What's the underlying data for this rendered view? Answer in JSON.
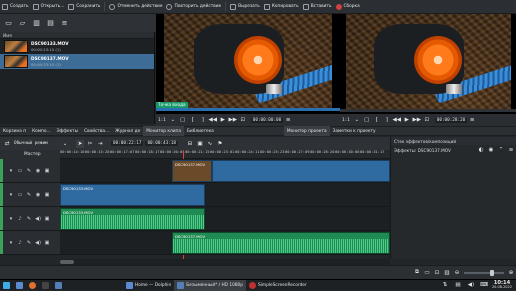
{
  "menu": {
    "items": [
      {
        "label": "Создать",
        "icon": "new-file-icon"
      },
      {
        "label": "Открыть...",
        "icon": "open-folder-icon"
      },
      {
        "label": "Сохранить",
        "icon": "save-icon"
      },
      {
        "label": "Отменить действие",
        "icon": "undo-icon"
      },
      {
        "label": "Повторить действие",
        "icon": "redo-icon"
      },
      {
        "label": "Вырезать",
        "icon": "cut-icon"
      },
      {
        "label": "Копировать",
        "icon": "copy-icon"
      },
      {
        "label": "Вставить",
        "icon": "paste-icon"
      },
      {
        "label": "Сборка",
        "icon": "render-icon"
      }
    ]
  },
  "bin": {
    "header": "Имя",
    "clips": [
      {
        "name": "DSC90133.MOV",
        "duration": "00:00:23:10 (1)"
      },
      {
        "name": "DSC90137.MOV",
        "duration": "00:00:23:10 (1)"
      }
    ]
  },
  "clip_monitor": {
    "zone_label": "Точка входа",
    "zoom": "1:1",
    "timecode": "00:00:00:00"
  },
  "project_monitor": {
    "zoom": "1:1",
    "timecode": "00:00:28:20"
  },
  "tabs": {
    "left": [
      "Корзина п",
      "Компо...",
      "Эффекты",
      "Свойства...",
      "Журнал де",
      "Монитор клипа",
      "Библиотека"
    ],
    "right": [
      "Монитор проекта",
      "Заметки к проекту"
    ]
  },
  "timeline": {
    "mode": "Обычный режим",
    "position": "00:00:22:17",
    "duration": "00:00:43:18",
    "master_label": "Мастер",
    "ruler_ticks": [
      "00:00:14:10",
      "00:00:15:20",
      "00:00:17:07",
      "00:00:18:17",
      "00:00:20:04",
      "00:00:21:15",
      "00:00:23:01",
      "00:00:24:11",
      "00:00:25:23",
      "00:00:27:09",
      "00:00:28:20",
      "00:00:30:06",
      "00:00:31:17"
    ],
    "clips": {
      "v2": "DSC90137.MOV",
      "v1": "DSC90133.MOV",
      "a1": "DSC90133.MOV",
      "a2": "DSC90137.MOV"
    }
  },
  "effects": {
    "title": "Стек эффектов/композиций",
    "clip": "Эффекты: DSC90137.MOV"
  },
  "taskbar": {
    "items": [
      {
        "label": "Home — Dolphin"
      },
      {
        "label": "Безымянный* / HD 1080p"
      },
      {
        "label": "SimpleScreenRecorder"
      }
    ],
    "clock": "10:14",
    "date": "20.08.2022"
  }
}
